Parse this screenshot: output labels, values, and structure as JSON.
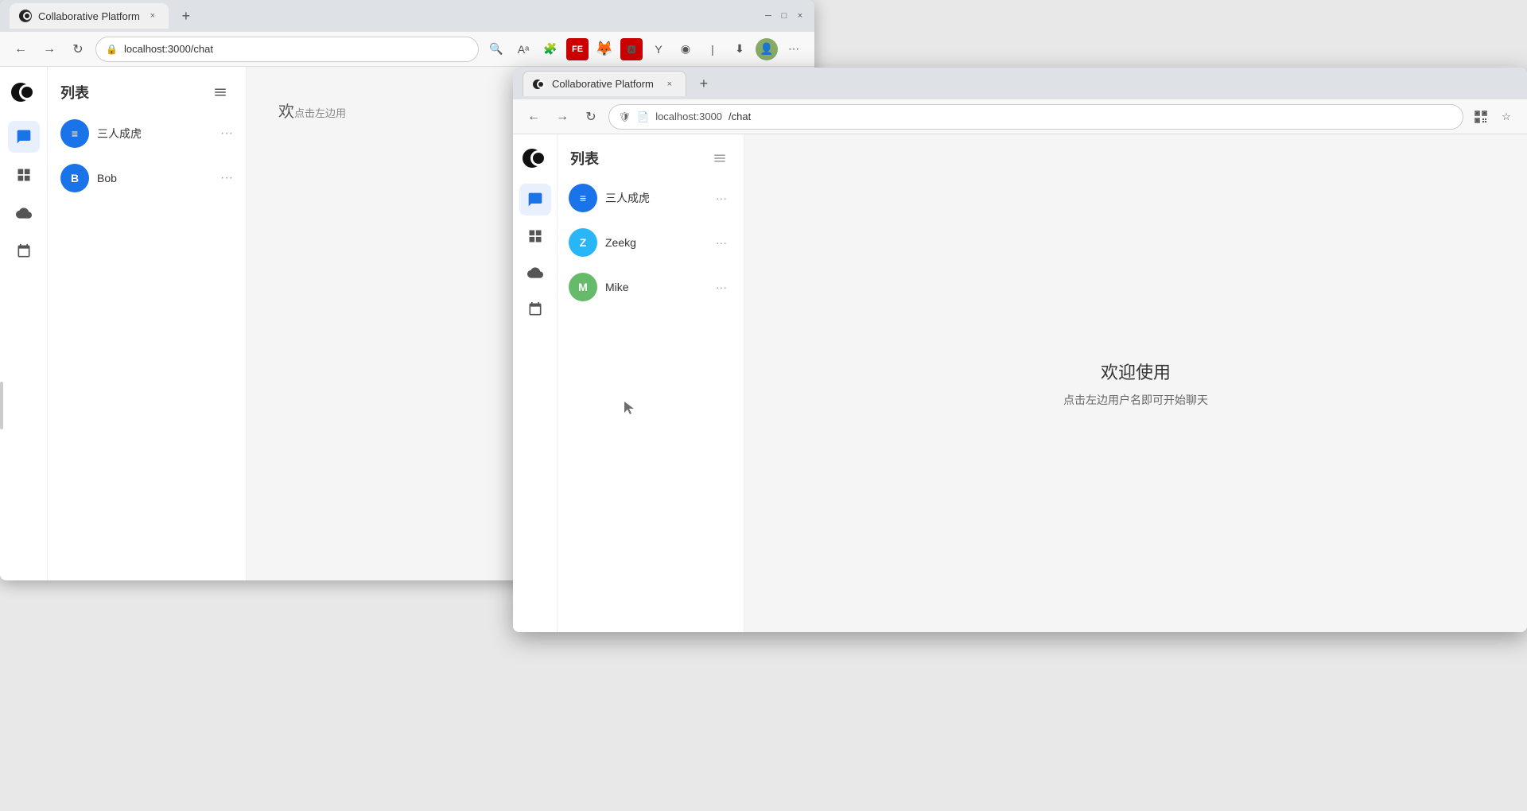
{
  "bg_browser": {
    "tab_label": "Collaborative Platform",
    "tab_close": "×",
    "new_tab": "+",
    "address": "localhost:3000/chat",
    "win_minimize": "─",
    "win_maximize": "□",
    "win_close": "×",
    "nav_back": "←",
    "nav_forward": "→",
    "nav_refresh": "↻"
  },
  "fg_browser": {
    "tab_label": "Collaborative Platform",
    "tab_close": "×",
    "new_tab": "+",
    "address": "localhost:3000/chat",
    "nav_back": "←",
    "nav_forward": "→",
    "nav_refresh": "↻",
    "bookmark_icon": "☆"
  },
  "bg_app": {
    "list_title": "列表",
    "items": [
      {
        "name": "三人成虎",
        "avatar_text": "≡",
        "avatar_bg": "#1a73e8"
      },
      {
        "name": "Bob",
        "avatar_text": "B",
        "avatar_bg": "#1a73e8"
      }
    ],
    "welcome_title": "欢",
    "welcome_subtitle": "点击左边用"
  },
  "fg_app": {
    "list_title": "列表",
    "items": [
      {
        "name": "三人成虎",
        "avatar_text": "≡",
        "avatar_bg": "#1a73e8",
        "key": "sanren"
      },
      {
        "name": "Zeekg",
        "avatar_text": "Z",
        "avatar_bg": "#29b6f6",
        "key": "zeekg"
      },
      {
        "name": "Mike",
        "avatar_text": "M",
        "avatar_bg": "#66bb6a",
        "key": "mike"
      }
    ],
    "welcome_title": "欢迎使用",
    "welcome_subtitle": "点击左边用户名即可开始聊天"
  },
  "icons": {
    "chat": "💬",
    "grid": "⊞",
    "cloud": "☁",
    "calendar": "📅",
    "menu": "☰",
    "more": "•••",
    "shield": "🛡",
    "lock": "🔒",
    "search": "🔍",
    "star": "☆",
    "qr": "⊞",
    "settings": "⚙"
  }
}
